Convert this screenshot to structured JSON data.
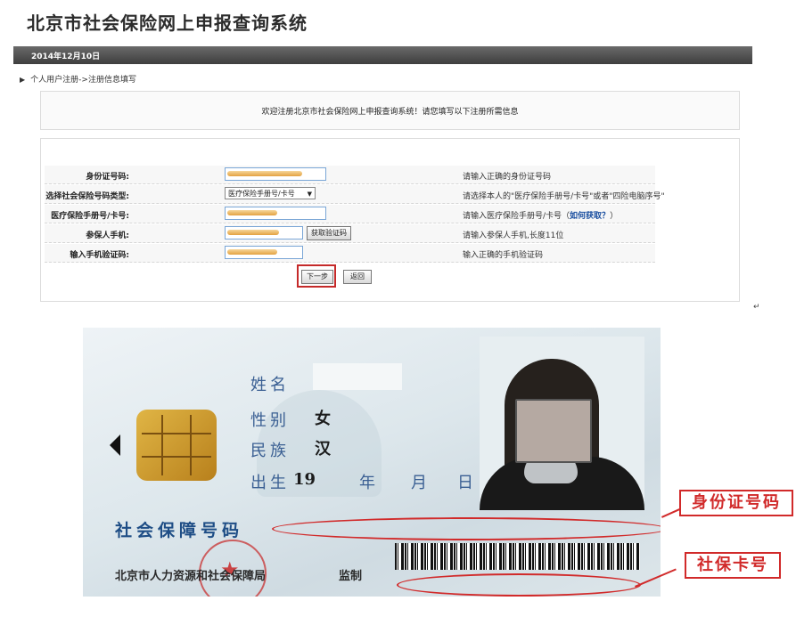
{
  "page": {
    "site_title": "北京市社会保险网上申报查询系统",
    "date": "2014年12月10日",
    "breadcrumb": "个人用户注册->注册信息填写",
    "welcome_text": "欢迎注册北京市社会保险网上申报查询系统！请您填写以下注册所需信息"
  },
  "form": {
    "rows": [
      {
        "label": "身份证号码:",
        "hint": "请输入正确的身份证号码"
      },
      {
        "label": "选择社会保险号码类型:",
        "select_value": "医疗保险手册号/卡号",
        "hint": "请选择本人的\"医疗保险手册号/卡号\"或者\"四险电脑序号\""
      },
      {
        "label": "医疗保险手册号/卡号:",
        "hint": "请输入医疗保险手册号/卡号（",
        "hint_link": "如何获取？",
        "hint_tail": "）"
      },
      {
        "label": "参保人手机:",
        "button": "获取验证码",
        "hint": "请输入参保人手机,长度11位"
      },
      {
        "label": "输入手机验证码:",
        "hint": "输入正确的手机验证码"
      }
    ],
    "next_button": "下一步",
    "back_button": "返回"
  },
  "card": {
    "name_label": "姓名",
    "sex_label": "性别",
    "sex_value": "女",
    "ethnicity_label": "民族",
    "ethnicity_value": "汉",
    "birth_label": "出生",
    "birth_year_prefix": "19",
    "year_label": "年",
    "month_label": "月",
    "day_label": "日",
    "ss_number_label": "社会保障号码",
    "issuer": "北京市人力资源和社会保障局",
    "supervise": "监制"
  },
  "callouts": {
    "id_number": "身份证号码",
    "card_number": "社保卡号"
  },
  "colors": {
    "annotation_red": "#d12a2a",
    "card_label_blue": "#3a5f93"
  }
}
